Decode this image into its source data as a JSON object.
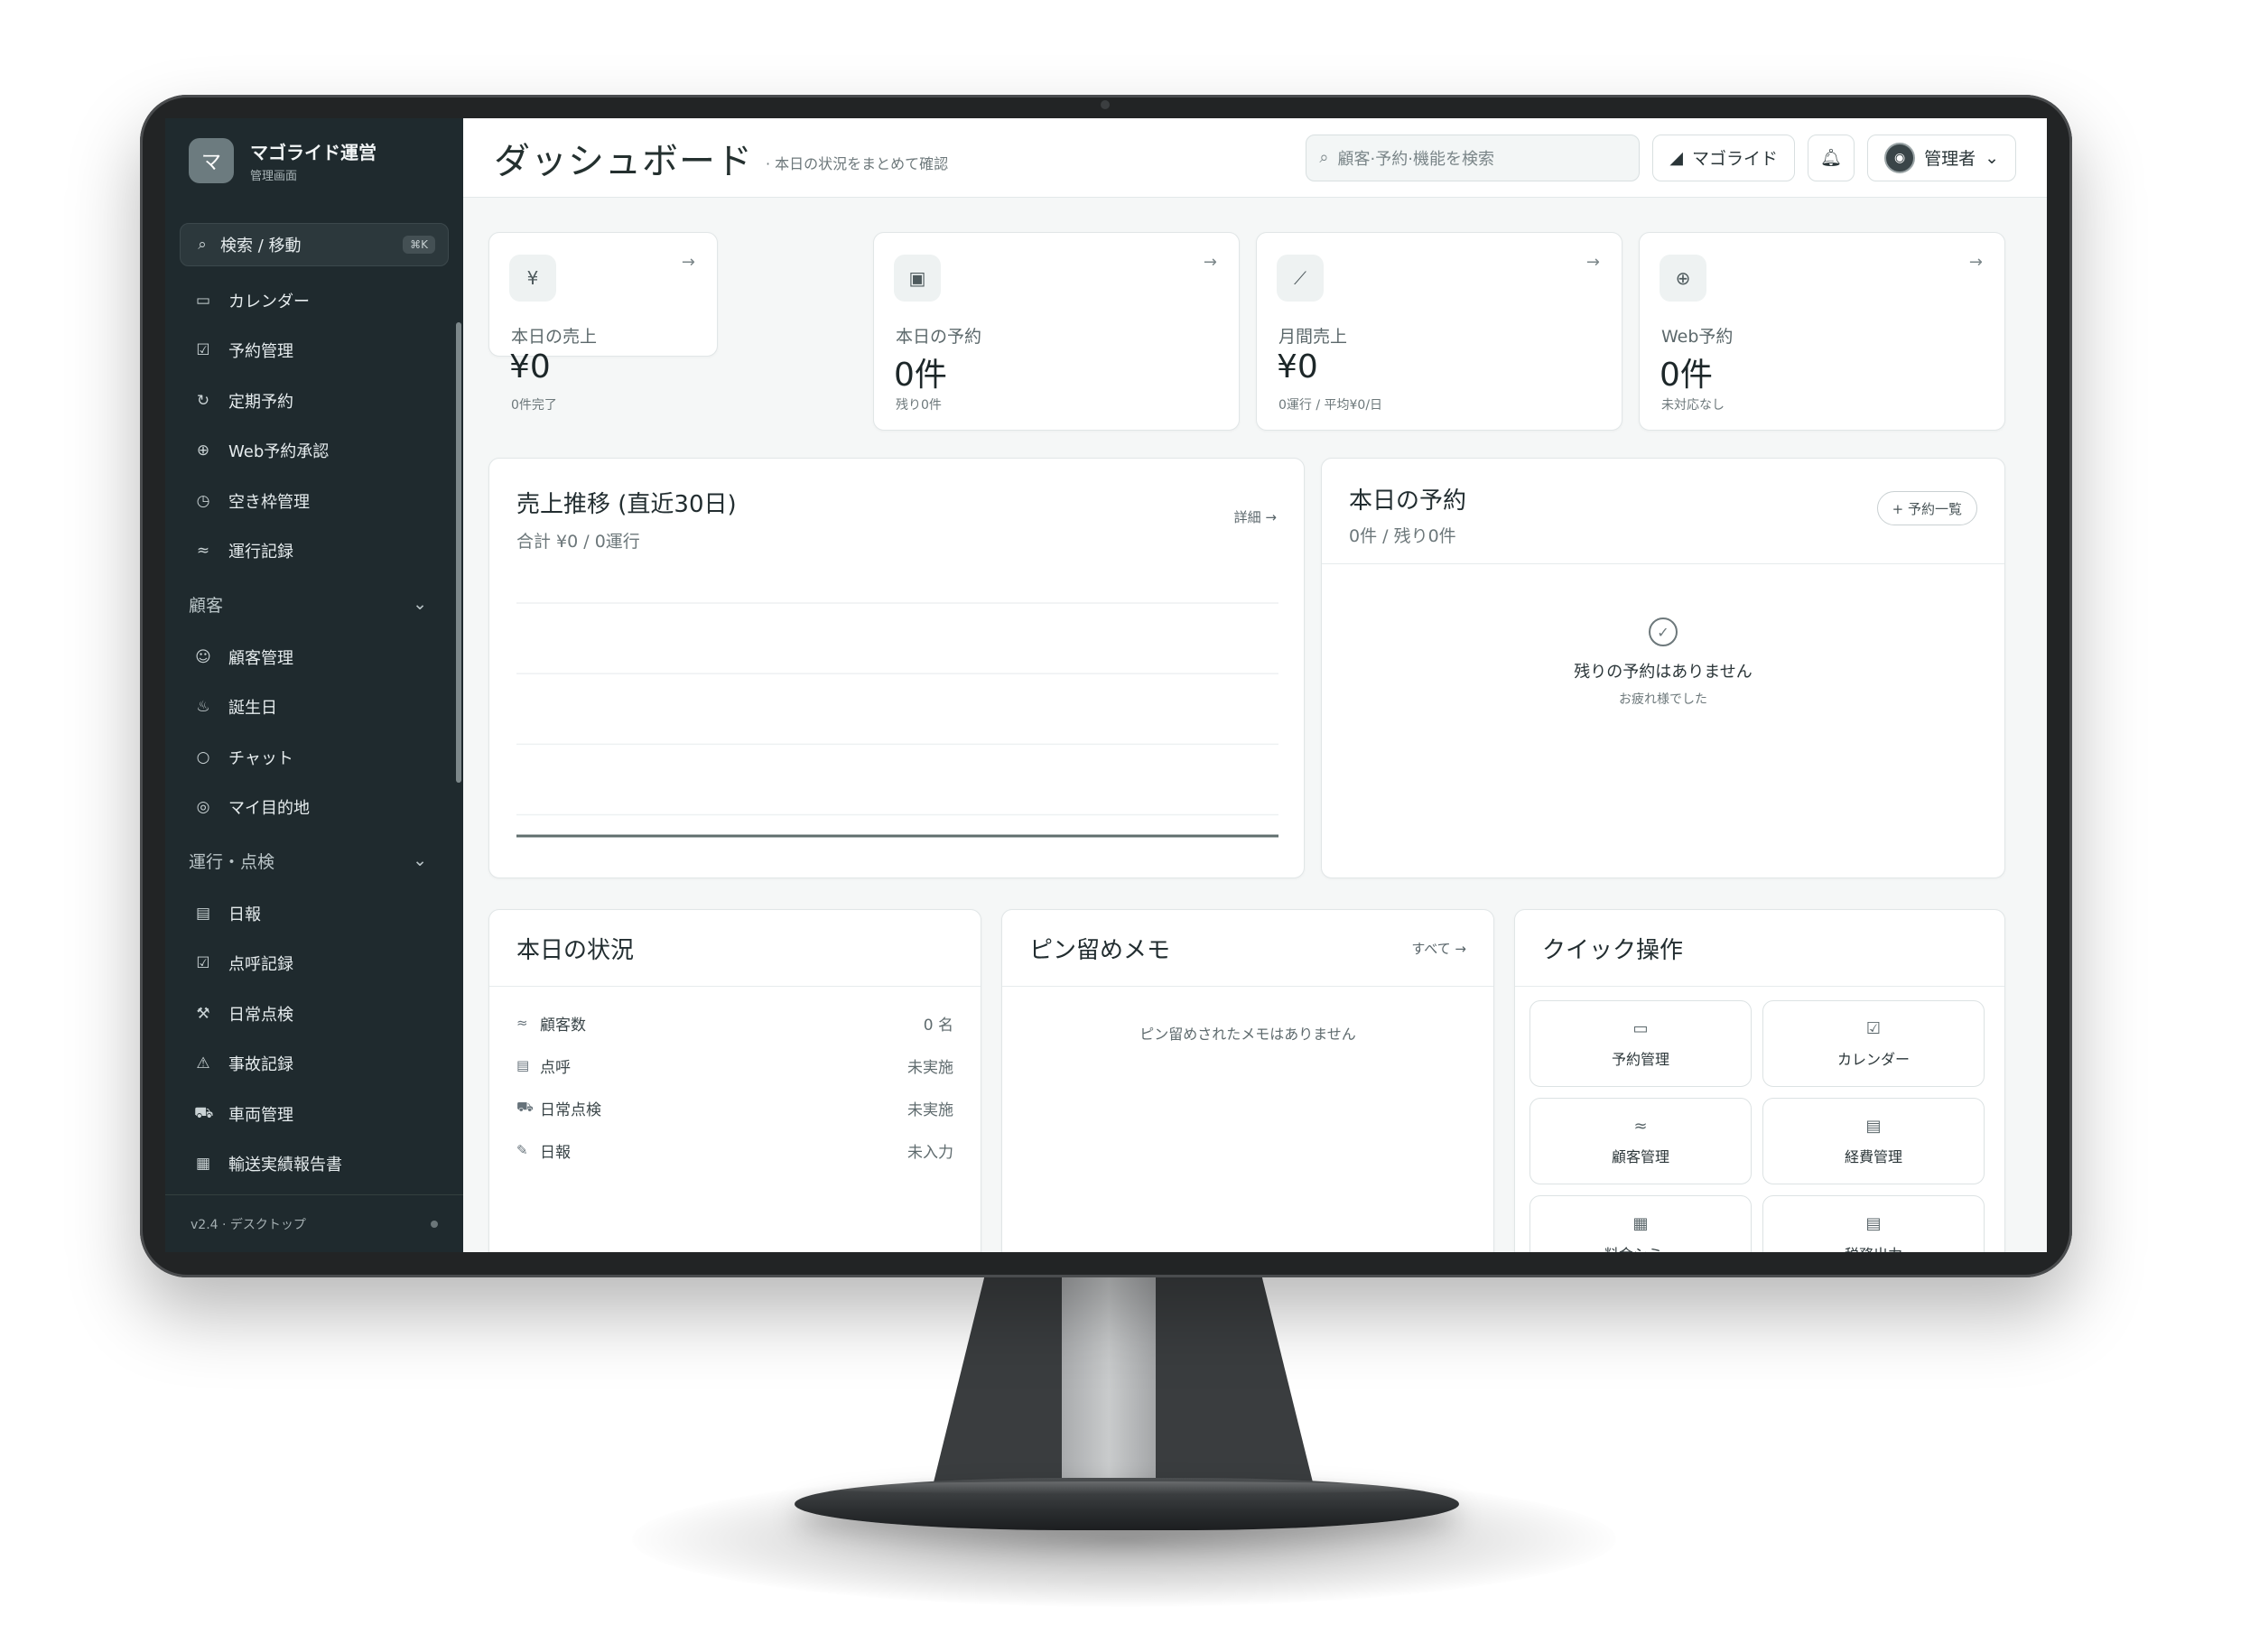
{
  "brand": {
    "logo_glyph": "マ",
    "title": "マゴライド運営",
    "subtitle": "管理画面"
  },
  "sidebar": {
    "search_label": "検索 / 移動",
    "search_shortcut": "⌘K",
    "items_top": [
      {
        "label": "カレンダー",
        "icon": "calendar-icon"
      },
      {
        "label": "予約管理",
        "icon": "calendar-check-icon"
      },
      {
        "label": "定期予約",
        "icon": "repeat-icon"
      },
      {
        "label": "Web予約承認",
        "icon": "globe-icon"
      },
      {
        "label": "空き枠管理",
        "icon": "clock-icon"
      },
      {
        "label": "運行記録",
        "icon": "route-icon"
      }
    ],
    "section_customers": "顧客",
    "items_customers": [
      {
        "label": "顧客管理",
        "icon": "users-icon"
      },
      {
        "label": "誕生日",
        "icon": "cake-icon"
      },
      {
        "label": "チャット",
        "icon": "chat-icon"
      },
      {
        "label": "マイ目的地",
        "icon": "map-pin-icon"
      }
    ],
    "section_operations": "運行・点検",
    "items_operations": [
      {
        "label": "日報",
        "icon": "clipboard-icon"
      },
      {
        "label": "点呼記録",
        "icon": "checkbox-icon"
      },
      {
        "label": "日常点検",
        "icon": "wrench-icon"
      },
      {
        "label": "事故記録",
        "icon": "warning-icon"
      },
      {
        "label": "車両管理",
        "icon": "car-icon"
      },
      {
        "label": "輸送実績報告書",
        "icon": "document-icon"
      }
    ],
    "footer_version": "v2.4 · デスクトップ"
  },
  "header": {
    "title": "ダッシュボード",
    "subtitle": "· 本日の状況をまとめて確認",
    "search_placeholder": "顧客·予約·機能を検索",
    "brand_button": "マゴライド",
    "user_label": "管理者"
  },
  "stats": [
    {
      "icon": "yen-icon",
      "label": "本日の売上",
      "value": "¥0",
      "note": "0件完了"
    },
    {
      "icon": "calendar-icon",
      "label": "本日の予約",
      "value": "0件",
      "note": "残り0件"
    },
    {
      "icon": "chart-line-icon",
      "label": "月間売上",
      "value": "¥0",
      "note": "0運行 / 平均¥0/日"
    },
    {
      "icon": "globe-icon",
      "label": "Web予約",
      "value": "0件",
      "note": "未対応なし"
    }
  ],
  "sales_chart": {
    "title": "売上推移 (直近30日)",
    "summary": "合計 ¥0 / 0運行",
    "detail_link": "詳細 →"
  },
  "chart_data": {
    "type": "line",
    "title": "売上推移 (直近30日)",
    "series": [
      {
        "values": [
          0,
          0,
          0,
          0,
          0,
          0,
          0,
          0,
          0,
          0,
          0,
          0,
          0,
          0,
          0,
          0,
          0,
          0,
          0,
          0,
          0,
          0,
          0,
          0,
          0,
          0,
          0,
          0,
          0,
          0
        ]
      }
    ],
    "grid": true
  },
  "today_reservations": {
    "title": "本日の予約",
    "sub": "0件 / 残り0件",
    "button": "+ 予約一覧",
    "empty_title": "残りの予約はありません",
    "empty_sub": "お疲れ様でした"
  },
  "status": {
    "title": "本日の状況",
    "rows": [
      {
        "icon": "route-icon",
        "label": "顧客数",
        "value": "0 名"
      },
      {
        "icon": "clipboard-icon",
        "label": "点呼",
        "value": "未実施"
      },
      {
        "icon": "car-icon",
        "label": "日常点検",
        "value": "未実施"
      },
      {
        "icon": "edit-icon",
        "label": "日報",
        "value": "未入力"
      }
    ]
  },
  "memo": {
    "title": "ピン留めメモ",
    "link": "すべて →",
    "empty": "ピン留めされたメモはありません"
  },
  "quick": {
    "title": "クイック操作",
    "buttons": [
      {
        "label": "予約管理",
        "icon": "calendar-icon"
      },
      {
        "label": "カレンダー",
        "icon": "calendar-check-icon"
      },
      {
        "label": "顧客管理",
        "icon": "route-icon"
      },
      {
        "label": "経費管理",
        "icon": "receipt-icon"
      },
      {
        "label": "料金シミュ",
        "icon": "calculator-icon"
      },
      {
        "label": "税務出力",
        "icon": "receipt-icon"
      }
    ]
  }
}
